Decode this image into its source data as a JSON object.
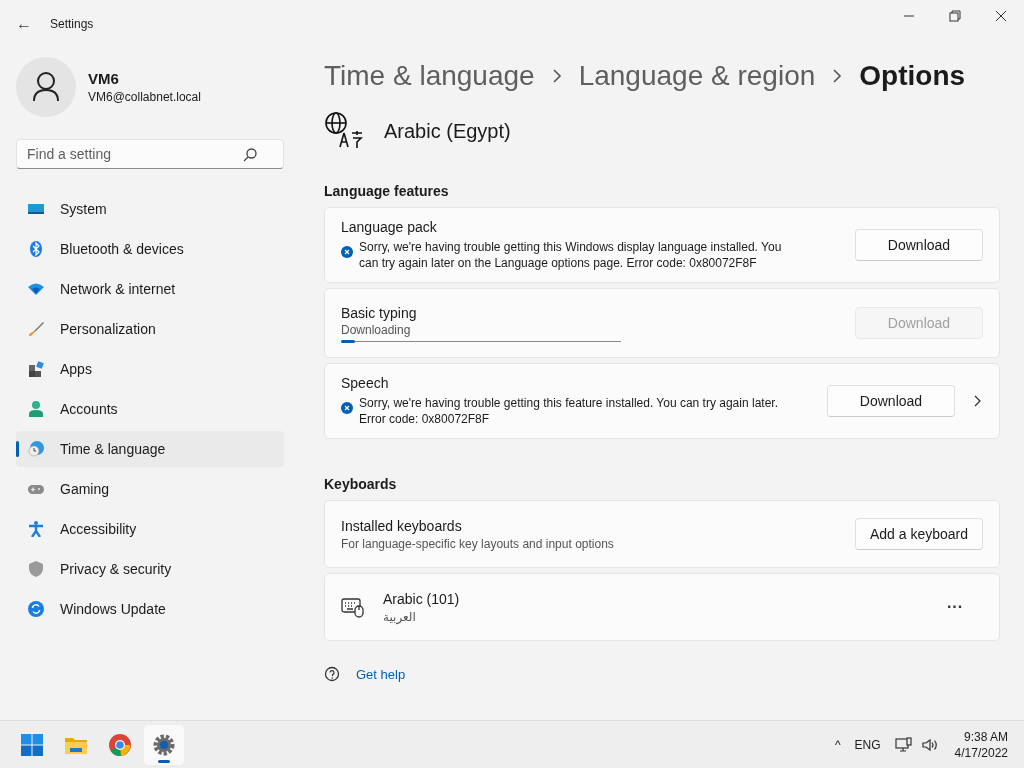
{
  "window": {
    "title": "Settings",
    "back": "←"
  },
  "profile": {
    "name": "VM6",
    "email": "VM6@collabnet.local"
  },
  "search": {
    "placeholder": "Find a setting"
  },
  "sidebar": {
    "items": [
      {
        "label": "System",
        "kind": "system",
        "selected": false
      },
      {
        "label": "Bluetooth & devices",
        "kind": "bluetooth",
        "selected": false
      },
      {
        "label": "Network & internet",
        "kind": "network",
        "selected": false
      },
      {
        "label": "Personalization",
        "kind": "brush",
        "selected": false
      },
      {
        "label": "Apps",
        "kind": "apps",
        "selected": false
      },
      {
        "label": "Accounts",
        "kind": "accounts",
        "selected": false
      },
      {
        "label": "Time & language",
        "kind": "time",
        "selected": true
      },
      {
        "label": "Gaming",
        "kind": "gaming",
        "selected": false
      },
      {
        "label": "Accessibility",
        "kind": "accessibility",
        "selected": false
      },
      {
        "label": "Privacy & security",
        "kind": "privacy",
        "selected": false
      },
      {
        "label": "Windows Update",
        "kind": "update",
        "selected": false
      }
    ]
  },
  "breadcrumb": [
    {
      "label": "Time & language",
      "current": false
    },
    {
      "label": "Language & region",
      "current": false
    },
    {
      "label": "Options",
      "current": true
    }
  ],
  "language": {
    "name": "Arabic (Egypt)"
  },
  "language_features": {
    "title": "Language features",
    "items": [
      {
        "kind": "error",
        "title": "Language pack",
        "message": "Sorry, we're having trouble getting this Windows display language installed. You can try again later on the Language options page. Error code: 0x80072F8F",
        "button": "Download",
        "disabled": false,
        "chevron": false
      },
      {
        "kind": "progress",
        "title": "Basic typing",
        "status": "Downloading",
        "level": 0.05,
        "button": "Download",
        "disabled": true,
        "chevron": false
      },
      {
        "kind": "error",
        "title": "Speech",
        "message": "Sorry, we're having trouble getting this feature installed. You can try again later. Error code: 0x80072F8F",
        "button": "Download",
        "disabled": false,
        "chevron": true
      }
    ]
  },
  "keyboards": {
    "title": "Keyboards",
    "installed": {
      "title": "Installed keyboards",
      "subtitle": "For language-specific key layouts and input options",
      "button": "Add a keyboard"
    },
    "items": [
      {
        "name": "Arabic (101)",
        "native": "العربية",
        "more": "···"
      }
    ]
  },
  "help": {
    "label": "Get help"
  },
  "taskbar": {
    "apps": [
      {
        "kind": "start",
        "selected": false
      },
      {
        "kind": "explorer",
        "selected": false
      },
      {
        "kind": "chrome",
        "selected": false
      },
      {
        "kind": "settings",
        "selected": true
      }
    ],
    "tray": {
      "chevron": "^",
      "language": "ENG",
      "time": "9:38 AM",
      "date": "4/17/2022"
    }
  }
}
